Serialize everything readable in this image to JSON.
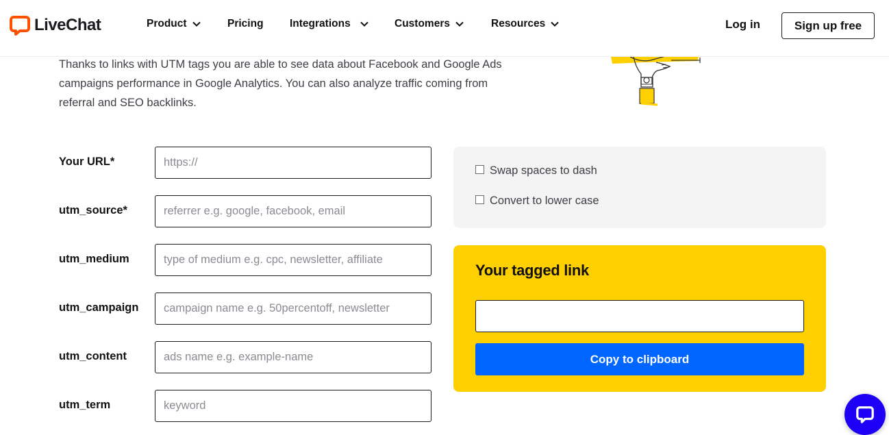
{
  "brand": {
    "name": "LiveChat",
    "logo_icon": "chat-bubble-icon",
    "logo_color": "#ff5100"
  },
  "nav": {
    "items": [
      {
        "label": "Product",
        "has_dropdown": true
      },
      {
        "label": "Pricing",
        "has_dropdown": false
      },
      {
        "label": "Integrations",
        "has_dropdown": true
      },
      {
        "label": "Customers",
        "has_dropdown": true
      },
      {
        "label": "Resources",
        "has_dropdown": true
      }
    ],
    "login_label": "Log in",
    "signup_label": "Sign up free"
  },
  "intro": {
    "text": "Thanks to links with UTM tags you are able to see data about Facebook and Google Ads campaigns performance in Google Analytics. You can also analyze traffic coming from referral and SEO backlinks."
  },
  "form": {
    "fields": [
      {
        "label": "Your URL*",
        "value": "",
        "placeholder": "https://"
      },
      {
        "label": "utm_source*",
        "value": "",
        "placeholder": "referrer e.g. google, facebook, email"
      },
      {
        "label": "utm_medium",
        "value": "",
        "placeholder": "type of medium e.g. cpc, newsletter, affiliate"
      },
      {
        "label": "utm_campaign",
        "value": "",
        "placeholder": "campaign name e.g. 50percentoff, newsletter"
      },
      {
        "label": "utm_content",
        "value": "",
        "placeholder": "ads name e.g. example-name"
      },
      {
        "label": "utm_term",
        "value": "",
        "placeholder": "keyword"
      }
    ]
  },
  "options": [
    {
      "label": "Swap spaces to dash",
      "checked": false
    },
    {
      "label": "Convert to lower case",
      "checked": false
    }
  ],
  "tagged_link": {
    "title": "Your tagged link",
    "value": "",
    "copy_label": "Copy to clipboard"
  },
  "colors": {
    "accent_yellow": "#ffd000",
    "button_blue": "#0066ff",
    "chat_fab": "#1d00f5",
    "brand_orange": "#ff5100"
  },
  "chat_widget": {
    "icon": "chat-bubble-icon"
  }
}
